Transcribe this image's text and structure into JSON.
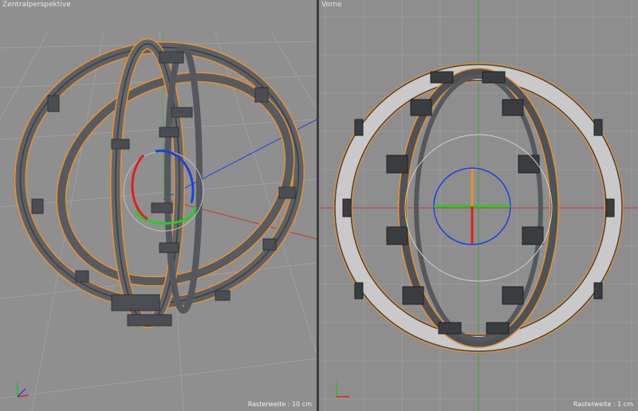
{
  "viewports": {
    "left": {
      "title": "Zentralperspektive",
      "grid_label": "Rasterweite : 10 cm"
    },
    "right": {
      "title": "Vorne",
      "grid_label": "Rasterweite : 1 cm"
    }
  },
  "colors": {
    "viewport_bg": "#8f8f8f",
    "grid_line": "#9c9c9c",
    "model": "#5a5e63",
    "model_edge": "#34373a",
    "selection": "#e8922b",
    "axis_x": "#e02020",
    "axis_y": "#20d020",
    "axis_z": "#2040e0"
  }
}
